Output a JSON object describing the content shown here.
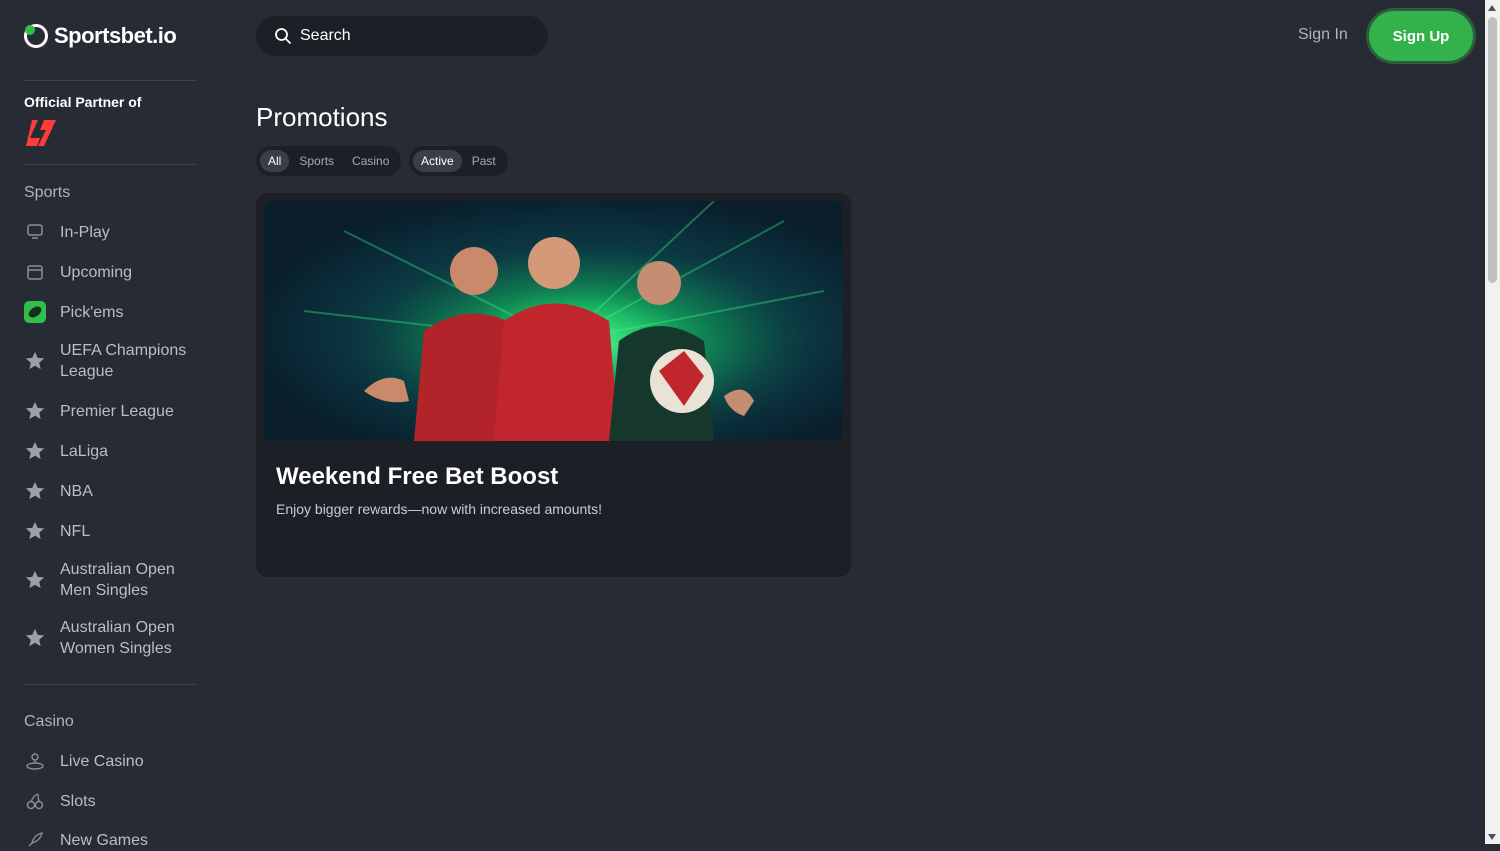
{
  "brand": {
    "name": "Sportsbet.io",
    "accent": "#33b14a"
  },
  "partner": {
    "title": "Official Partner of"
  },
  "sidebar": {
    "sports_title": "Sports",
    "sports_items": [
      {
        "label": "In-Play",
        "icon": "monitor-icon"
      },
      {
        "label": "Upcoming",
        "icon": "calendar-icon"
      },
      {
        "label": "Pick'ems",
        "icon": "pickems-icon"
      },
      {
        "label": "UEFA Champions League",
        "icon": "star-icon"
      },
      {
        "label": "Premier League",
        "icon": "star-icon"
      },
      {
        "label": "LaLiga",
        "icon": "star-icon"
      },
      {
        "label": "NBA",
        "icon": "star-icon"
      },
      {
        "label": "NFL",
        "icon": "star-icon"
      },
      {
        "label": "Australian Open Men Singles",
        "icon": "star-icon"
      },
      {
        "label": "Australian Open Women Singles",
        "icon": "star-icon"
      }
    ],
    "casino_title": "Casino",
    "casino_items": [
      {
        "label": "Live Casino",
        "icon": "dealer-icon"
      },
      {
        "label": "Slots",
        "icon": "cherries-icon"
      },
      {
        "label": "New Games",
        "icon": "rocket-icon"
      }
    ]
  },
  "header": {
    "search_label": "Search",
    "signin_label": "Sign In",
    "signup_label": "Sign Up"
  },
  "main": {
    "title": "Promotions",
    "category_filters": [
      {
        "label": "All",
        "selected": true
      },
      {
        "label": "Sports",
        "selected": false
      },
      {
        "label": "Casino",
        "selected": false
      }
    ],
    "status_filters": [
      {
        "label": "Active",
        "selected": true
      },
      {
        "label": "Past",
        "selected": false
      }
    ],
    "promo": {
      "title": "Weekend Free Bet Boost",
      "description": "Enjoy bigger rewards—now with increased amounts!"
    }
  }
}
